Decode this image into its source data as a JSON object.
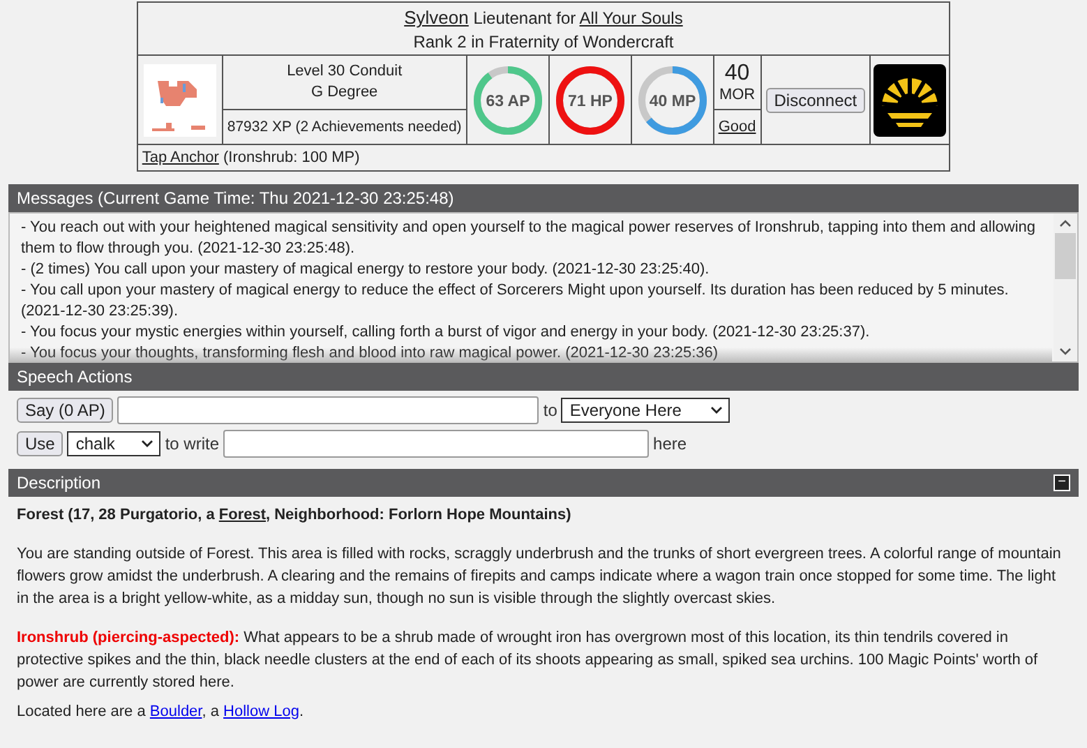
{
  "character": {
    "name": "Sylveon",
    "role": "Lieutenant for",
    "faction": "All Your Souls",
    "rank": "Rank 2 in Fraternity of Wondercraft",
    "level": "Level 30 Conduit",
    "degree": "G Degree",
    "xp": "87932 XP (2 Achievements needed)",
    "gauges": [
      {
        "label": "63 AP",
        "level": 0.9,
        "color": "#4fc78b"
      },
      {
        "label": "71 HP",
        "level": 1.0,
        "color": "#ee1111"
      },
      {
        "label": "40 MP",
        "level": 0.64,
        "color": "#3f9be0"
      }
    ],
    "morale_value": "40",
    "morale_unit": "MOR",
    "alignment": "Good",
    "disconnect": "Disconnect",
    "anchor_link": "Tap Anchor",
    "anchor_note": "(Ironshrub: 100 MP)"
  },
  "messages": {
    "title": "Messages (Current Game Time: Thu 2021-12-30 23:25:48)",
    "items": [
      "- You reach out with your heightened magical sensitivity and open yourself to the magical power reserves of Ironshrub, tapping into them and allowing them to flow through you. (2021-12-30 23:25:48).",
      "- (2 times) You call upon your mastery of magical energy to restore your body. (2021-12-30 23:25:40).",
      "- You call upon your mastery of magical energy to reduce the effect of Sorcerers Might upon yourself. Its duration has been reduced by 5 minutes. (2021-12-30 23:25:39).",
      "- You focus your mystic energies within yourself, calling forth a burst of vigor and energy in your body. (2021-12-30 23:25:37).",
      "- You focus your thoughts, transforming flesh and blood into raw magical power. (2021-12-30 23:25:36)"
    ]
  },
  "speech": {
    "title": "Speech Actions",
    "say_button": "Say (0 AP)",
    "to": "to",
    "target": "Everyone Here",
    "use_button": "Use",
    "tool": "chalk",
    "to_write": "to write",
    "here": "here"
  },
  "description": {
    "title": "Description",
    "collapse": "−",
    "location_pre": "Forest (17, 28 Purgatorio, a ",
    "location_link": "Forest",
    "location_post": ", Neighborhood: Forlorn Hope Mountains)",
    "text": "You are standing outside of Forest. This area is filled with rocks, scraggly underbrush and the trunks of short evergreen trees. A colorful range of mountain flowers grow amidst the underbrush. A clearing and the remains of firepits and camps indicate where a wagon train once stopped for some time. The light in the area is a bright yellow-white, as a midday sun, though no sun is visible through the slightly overcast skies.",
    "feature_name": "Ironshrub (piercing-aspected):",
    "feature_text": "What appears to be a shrub made of wrought iron has overgrown most of this location, its thin tendrils covered in protective spikes and the thin, black needle clusters at the end of each of its shoots appearing as small, spiked sea urchins. 100 Magic Points' worth of power are currently stored here.",
    "located": [
      {
        "kind": "text",
        "text": "Located here are a"
      },
      {
        "kind": "link",
        "text": "Boulder"
      },
      {
        "kind": "text",
        "text": ", a"
      },
      {
        "kind": "link",
        "text": "Hollow Log"
      },
      {
        "kind": "text",
        "text": "."
      }
    ]
  }
}
